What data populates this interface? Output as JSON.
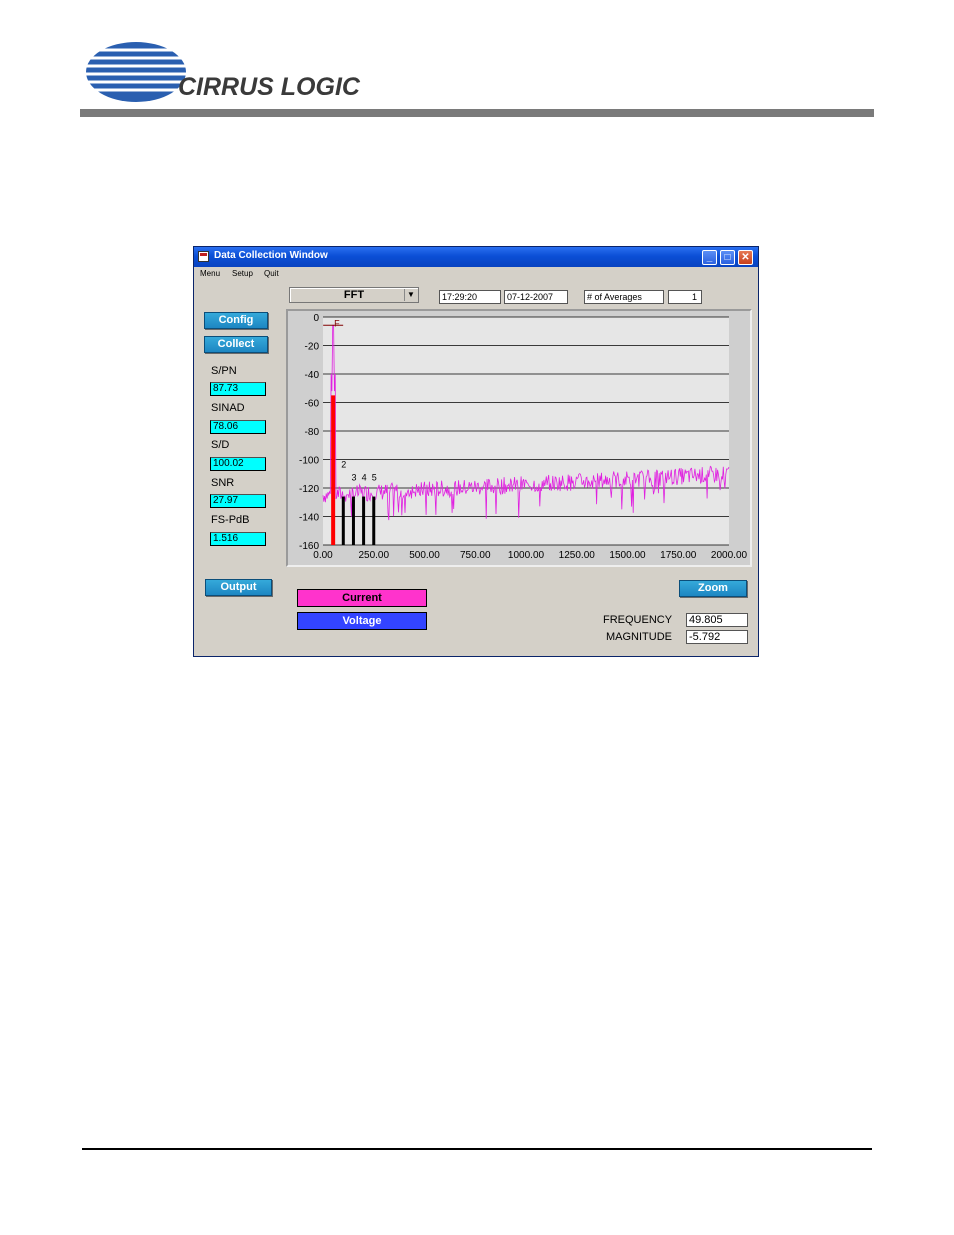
{
  "header": {
    "logo_text": "CIRRUS LOGIC"
  },
  "window": {
    "title": "Data Collection Window",
    "controls": {
      "minimize": "_",
      "maximize": "□",
      "close": "✕"
    },
    "menu": [
      "Menu",
      "Setup",
      "Quit"
    ]
  },
  "toolbar": {
    "mode": "FFT",
    "time": "17:29:20",
    "date": "07-12-2007",
    "averages_label": "# of Averages",
    "averages_value": "1"
  },
  "buttons": {
    "config": "Config",
    "collect": "Collect",
    "output": "Output",
    "zoom": "Zoom"
  },
  "metrics": [
    {
      "label": "S/PN",
      "value": "87.73"
    },
    {
      "label": "SINAD",
      "value": "78.06"
    },
    {
      "label": "S/D",
      "value": "100.02"
    },
    {
      "label": "SNR",
      "value": "27.97"
    },
    {
      "label": "FS-PdB",
      "value": "1.516"
    }
  ],
  "legend": {
    "current": "Current",
    "voltage": "Voltage"
  },
  "readout": {
    "frequency_label": "FREQUENCY",
    "frequency_value": "49.805",
    "magnitude_label": "MAGNITUDE",
    "magnitude_value": "-5.792"
  },
  "chart_data": {
    "type": "line",
    "xlim": [
      0,
      2000
    ],
    "ylim": [
      -160,
      0
    ],
    "xticks": [
      "0.00",
      "250.00",
      "500.00",
      "750.00",
      "1000.00",
      "1250.00",
      "1500.00",
      "1750.00",
      "2000.00"
    ],
    "yticks": [
      "0",
      "-20",
      "-40",
      "-60",
      "-80",
      "-100",
      "-120",
      "-140",
      "-160"
    ],
    "grid": true,
    "fundamental": {
      "label": "F",
      "x": 50,
      "y": -5.8
    },
    "harmonics": [
      {
        "label": "2",
        "x": 100,
        "y": -107
      },
      {
        "label": "3",
        "x": 150,
        "y": -116
      },
      {
        "label": "4",
        "x": 200,
        "y": -116
      },
      {
        "label": "5",
        "x": 250,
        "y": -116
      }
    ],
    "series": [
      {
        "color": "#e020e0",
        "noise_floor_start": -125,
        "noise_floor_end": -110
      },
      {
        "color": "#ff0000"
      }
    ]
  }
}
